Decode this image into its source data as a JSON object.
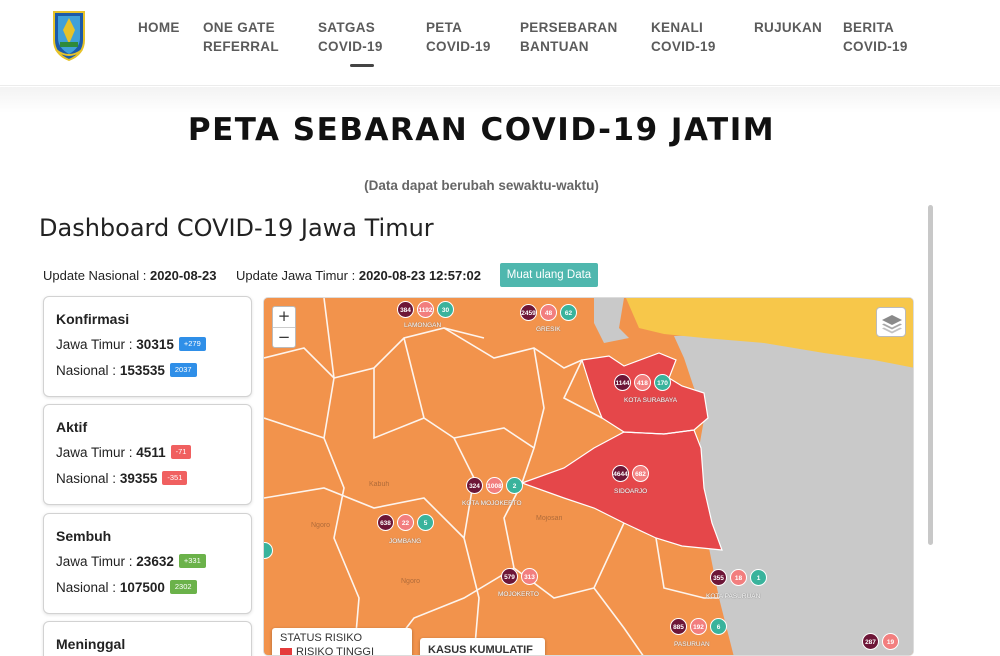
{
  "nav": {
    "items": [
      {
        "line1": "HOME",
        "line2": ""
      },
      {
        "line1": "ONE GATE",
        "line2": "REFERRAL"
      },
      {
        "line1": "SATGAS",
        "line2": "COVID-19"
      },
      {
        "line1": "PETA",
        "line2": "COVID-19"
      },
      {
        "line1": "PERSEBARAN",
        "line2": "BANTUAN"
      },
      {
        "line1": "KENALI",
        "line2": "COVID-19"
      },
      {
        "line1": "RUJUKAN",
        "line2": ""
      },
      {
        "line1": "BERITA",
        "line2": "COVID-19"
      }
    ]
  },
  "header": {
    "title": "PETA SEBARAN COVID-19 JATIM",
    "subtitle": "(Data dapat berubah sewaktu-waktu)"
  },
  "dashboard": {
    "title": "Dashboard COVID-19 Jawa Timur",
    "update_nasional_label": "Update Nasional :",
    "update_nasional_value": "2020-08-23",
    "update_jatim_label": "Update Jawa Timur :",
    "update_jatim_value": "2020-08-23 12:57:02",
    "reload_label": "Muat ulang Data"
  },
  "cards": {
    "konfirmasi": {
      "title": "Konfirmasi",
      "jatim_label": "Jawa Timur :",
      "jatim_value": "30315",
      "jatim_delta": "+279",
      "nasional_label": "Nasional :",
      "nasional_value": "153535",
      "nasional_delta": "2037"
    },
    "aktif": {
      "title": "Aktif",
      "jatim_label": "Jawa Timur :",
      "jatim_value": "4511",
      "jatim_delta": "-71",
      "nasional_label": "Nasional :",
      "nasional_value": "39355",
      "nasional_delta": "-351"
    },
    "sembuh": {
      "title": "Sembuh",
      "jatim_label": "Jawa Timur :",
      "jatim_value": "23632",
      "jatim_delta": "+331",
      "nasional_label": "Nasional :",
      "nasional_value": "107500",
      "nasional_delta": "2302"
    },
    "meninggal": {
      "title": "Meninggal"
    }
  },
  "map": {
    "zoom_in": "+",
    "zoom_out": "−",
    "markers": [
      {
        "city": "LAMONGAN",
        "values": [
          "384",
          "1192",
          "30"
        ]
      },
      {
        "city": "GRESIK",
        "values": [
          "2459",
          "48",
          "62"
        ]
      },
      {
        "city": "KOTA SURABAYA",
        "values": [
          "1144",
          "418",
          "170"
        ]
      },
      {
        "city": "SIDOARJO",
        "values": [
          "4644",
          "682",
          ""
        ]
      },
      {
        "city": "KOTA MOJOKERTO",
        "values": [
          "324",
          "1008",
          "2"
        ]
      },
      {
        "city": "JOMBANG",
        "values": [
          "638",
          "22",
          "5"
        ]
      },
      {
        "city": "MOJOKERTO",
        "values": [
          "579",
          "313",
          ""
        ]
      },
      {
        "city": "KOTA PASURUAN",
        "values": [
          "355",
          "18",
          "1"
        ]
      },
      {
        "city": "PASURUAN",
        "values": [
          "885",
          "192",
          "6"
        ]
      },
      {
        "city": "",
        "values": [
          "287",
          "19",
          ""
        ]
      }
    ],
    "legend_title": "STATUS RISIKO",
    "legend_high": "RISIKO TINGGI",
    "kasus_title": "KASUS KUMULATIF",
    "colors": {
      "orange": "#f2934c",
      "red": "#e5474a",
      "yellow": "#f7c74a",
      "sea": "#c9c9c9",
      "border": "#ffffff"
    }
  }
}
